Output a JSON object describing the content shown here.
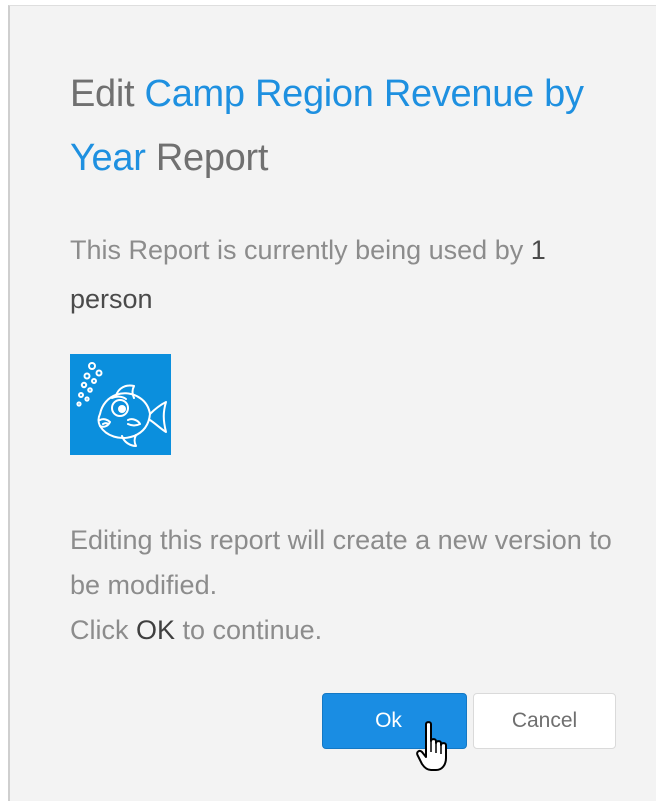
{
  "dialog": {
    "title": {
      "prefix": "Edit ",
      "report_name": "Camp Region Revenue by Year",
      "suffix": " Report"
    },
    "usage": {
      "text": "This Report is currently being used by ",
      "count_text": "1 person"
    },
    "avatar": {
      "icon": "fish-icon",
      "background_color": "#0b8fdd"
    },
    "message": {
      "line1": "Editing this report will create a new version to be modified.",
      "line2_prefix": "Click ",
      "line2_strong": "OK",
      "line2_suffix": " to continue."
    },
    "buttons": {
      "ok_label": "Ok",
      "cancel_label": "Cancel"
    },
    "colors": {
      "accent": "#1e90e0",
      "primary_button": "#1a8de3",
      "background": "#f3f3f3"
    }
  }
}
